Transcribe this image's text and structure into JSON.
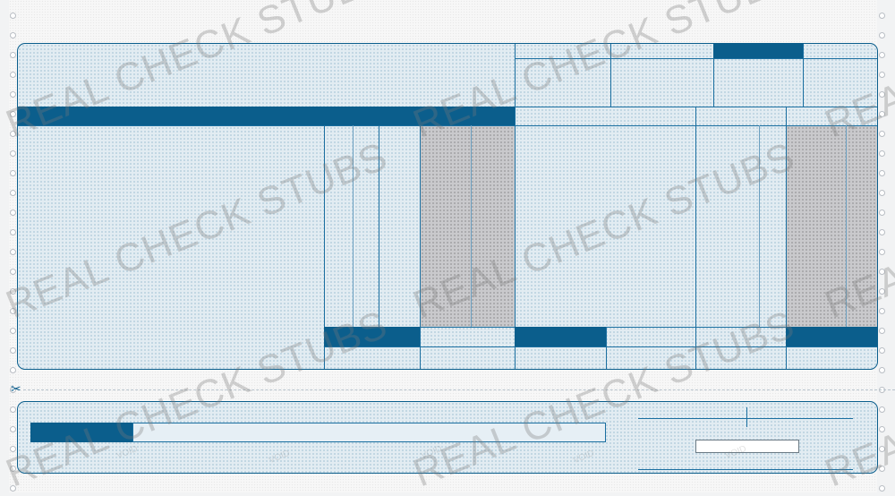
{
  "watermark": {
    "text": "REAL CHECK STUBS"
  },
  "void_pattern": {
    "text": "VOID"
  },
  "scissors": {
    "glyph": "✂"
  },
  "colors": {
    "accent": "#0b5e8c",
    "panel": "#e2ecf2",
    "shade": "#c9c9cc"
  }
}
